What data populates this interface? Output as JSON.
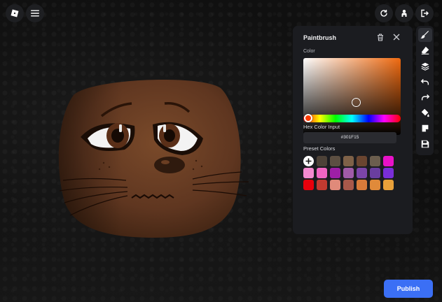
{
  "header": {
    "left_buttons": [
      {
        "icon": "roblox-logo-icon"
      },
      {
        "icon": "menu-icon"
      }
    ],
    "right_buttons": [
      {
        "icon": "reset-icon"
      },
      {
        "icon": "avatar-icon"
      },
      {
        "icon": "exit-icon"
      }
    ]
  },
  "panel": {
    "title": "Paintbrush",
    "color_label": "Color",
    "hex_label": "Hex Color Input",
    "hex_value": "#301F15",
    "preset_label": "Preset Colors",
    "base_hue": "#f06a10",
    "hue_knob_color": "#ff3a00",
    "presets": [
      "#4d4238",
      "#5c4f42",
      "#7e6148",
      "#6a4530",
      "#6b5e4e",
      "#e812c8",
      "#f48ad0",
      "#f065c2",
      "#9e1fa6",
      "#a05ba8",
      "#7c45a8",
      "#6a3ea0",
      "#7a2ed8",
      "#e8000c",
      "#c23a30",
      "#e08a7a",
      "#a8584a",
      "#d87a3a",
      "#e08a3a",
      "#e8a03a"
    ]
  },
  "tools": [
    {
      "icon": "paintbrush-icon",
      "active": true
    },
    {
      "icon": "eraser-icon"
    },
    {
      "icon": "layers-icon"
    },
    {
      "icon": "undo-icon"
    },
    {
      "icon": "redo-icon"
    },
    {
      "icon": "fill-bucket-icon"
    },
    {
      "icon": "sticker-icon"
    },
    {
      "icon": "save-icon"
    }
  ],
  "publish_label": "Publish"
}
